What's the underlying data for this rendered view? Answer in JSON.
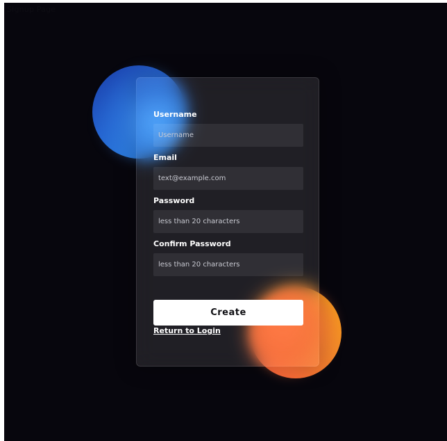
{
  "page": {
    "label": "Signup Page"
  },
  "form": {
    "username": {
      "label": "Username",
      "placeholder": "Username"
    },
    "email": {
      "label": "Email",
      "placeholder": "text@example.com"
    },
    "password": {
      "label": "Password",
      "placeholder": "less than 20 characters"
    },
    "confirm_password": {
      "label": "Confirm Password",
      "placeholder": "less than 20 characters"
    },
    "submit_label": "Create",
    "return_label": "Return to Login"
  },
  "colors": {
    "background": "#07060d",
    "blue_circle": "#2462cf",
    "orange_circle": "#f2862a",
    "button_background": "#ffffff"
  }
}
